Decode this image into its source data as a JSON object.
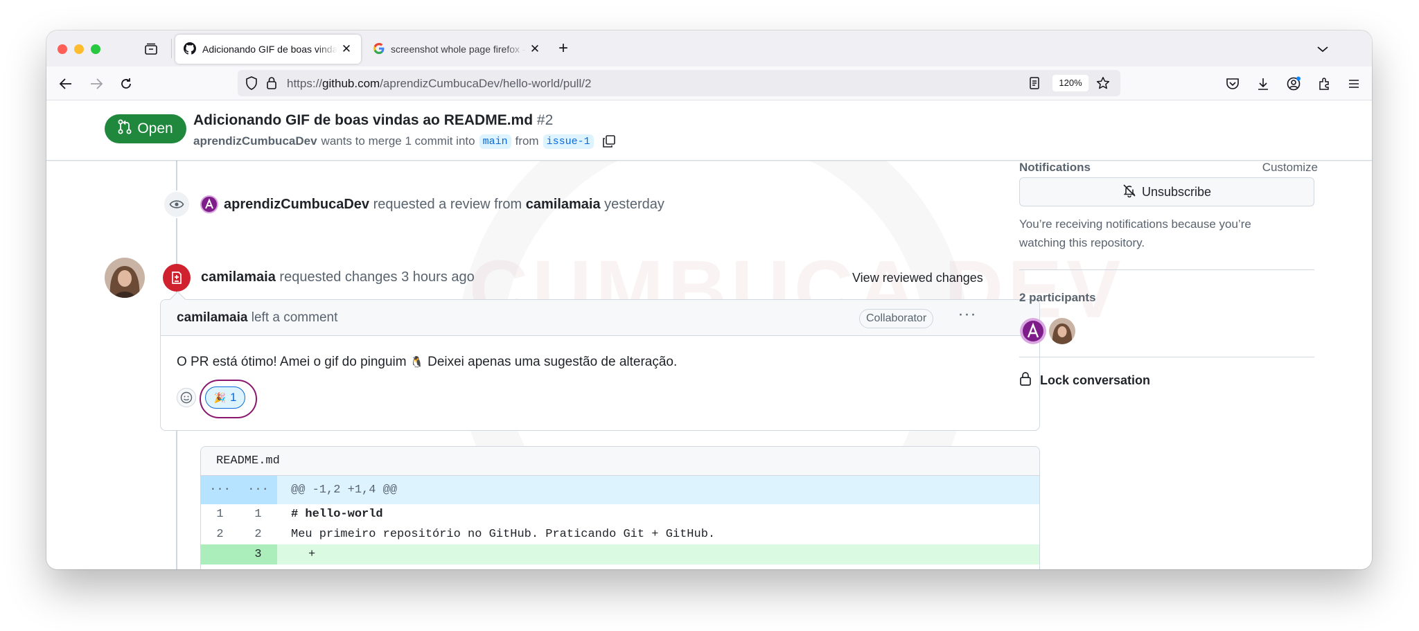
{
  "browser": {
    "tabs": [
      {
        "title": "Adicionando GIF de boas vindas ao README.md",
        "icon": "github-icon"
      },
      {
        "title": "screenshot whole page firefox - Google Search",
        "icon": "google-icon"
      }
    ],
    "url": {
      "prefix": "https://",
      "host": "github.com",
      "path": "/aprendizCumbucaDev/hello-world/pull/2"
    },
    "zoom": "120%"
  },
  "pr": {
    "state_label": "Open",
    "title": "Adicionando GIF de boas vindas ao README.md",
    "number": "#2",
    "author": "aprendizCumbucaDev",
    "merge_text": "wants to merge 1 commit into",
    "base_branch": "main",
    "from_text": "from",
    "head_branch": "issue-1"
  },
  "timeline": {
    "review_request": {
      "actor": "aprendizCumbucaDev",
      "text": "requested a review from",
      "reviewer": "camilamaia",
      "when": "yesterday"
    },
    "changes_request": {
      "actor": "camilamaia",
      "text": "requested changes 3 hours ago",
      "link": "View reviewed changes"
    },
    "comment": {
      "author": "camilamaia",
      "action": "left a comment",
      "role": "Collaborator",
      "body_before": "O PR está ótimo! Amei o gif do pinguim",
      "body_emoji": "🐧",
      "body_after": "Deixei apenas uma sugestão de alteração.",
      "reaction_emoji": "🎉",
      "reaction_count": "1"
    },
    "diff": {
      "file": "README.md",
      "hunk_left": "...",
      "hunk_right": "...",
      "hunk": "@@ -1,2 +1,4 @@",
      "lines": [
        {
          "old": "1",
          "new": "1",
          "text": "# hello-world"
        },
        {
          "old": "2",
          "new": "2",
          "text": "Meu primeiro repositório no GitHub. Praticando Git + GitHub."
        },
        {
          "old": "",
          "new": "3",
          "text": "+"
        }
      ]
    }
  },
  "sidebar": {
    "notifications_title": "Notifications",
    "customize": "Customize",
    "unsubscribe": "Unsubscribe",
    "notif_reason": "You’re receiving notifications because you’re watching this repository.",
    "participants_title": "2 participants",
    "lock": "Lock conversation"
  },
  "colors": {
    "open_green": "#1f883d",
    "changes_red": "#cf222e",
    "link_blue": "#0969da",
    "highlight_ring": "#8a1670"
  }
}
